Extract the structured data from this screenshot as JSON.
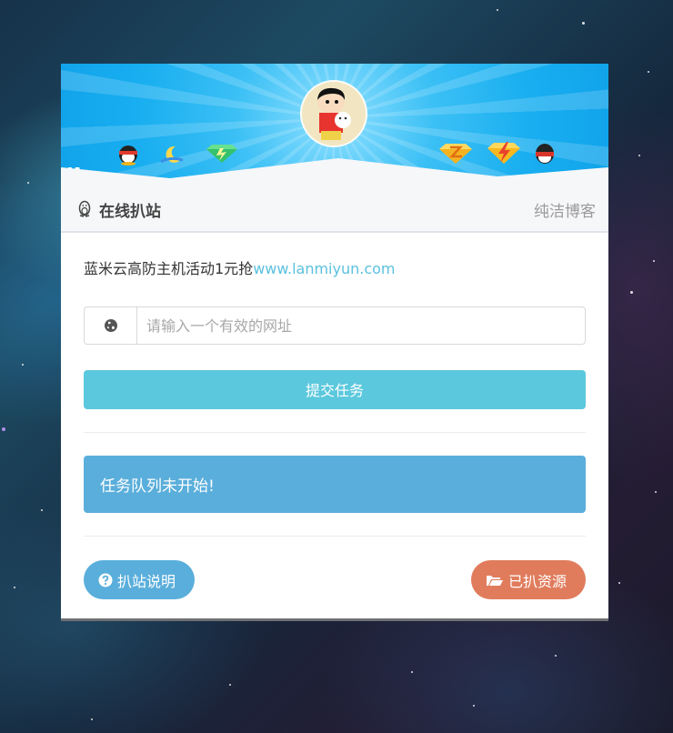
{
  "header": {
    "title": "在线扒站",
    "blog_link": "纯洁博客"
  },
  "ad": {
    "text": "蓝米云高防主机活动1元抢",
    "link": "www.lanmiyun.com"
  },
  "form": {
    "url_placeholder": "请输入一个有效的网址",
    "url_value": "",
    "submit_label": "提交任务"
  },
  "queue": {
    "status": "任务队列未开始!"
  },
  "footer": {
    "help_label": "扒站说明",
    "resources_label": "已扒资源"
  },
  "icons": {
    "header": "penguin-icon",
    "input_addon": "globe-icon",
    "help": "question-circle-icon",
    "resources": "folder-open-icon"
  },
  "colors": {
    "banner": "#18aef0",
    "submit": "#5bc8dd",
    "queue": "#5aaedb",
    "help_button": "#5aaedb",
    "resources_button": "#e07c5c",
    "link": "#5bc0de"
  }
}
